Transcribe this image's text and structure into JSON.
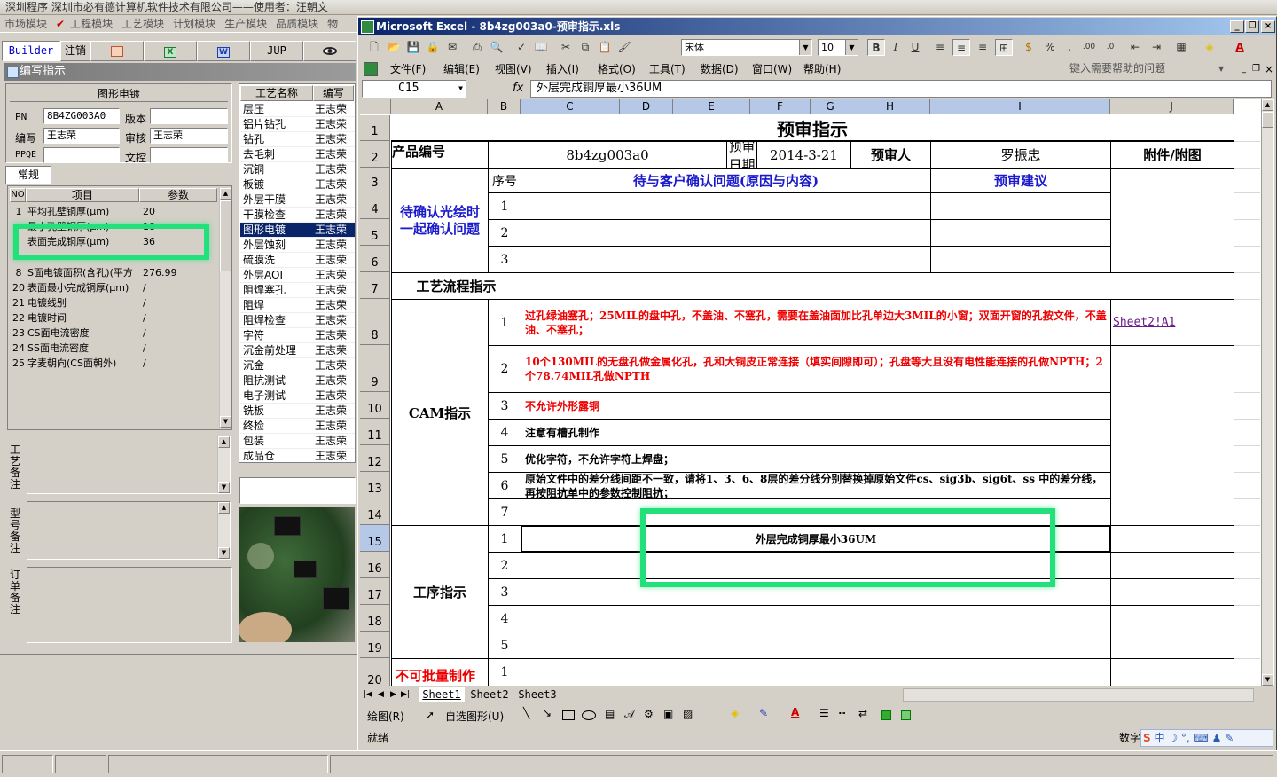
{
  "app": {
    "company_bar": "深圳程序    深圳市必有德计算机软件技术有限公司——使用者：汪朝文",
    "menu": [
      "市场模块",
      "工程模块",
      "工艺模块",
      "计划模块",
      "生产模块",
      "品质模块",
      "物"
    ]
  },
  "toolbar_tabs": [
    {
      "label": "Builder",
      "icon": null
    },
    {
      "label": "注销",
      "icon": null
    },
    {
      "label": "",
      "icon": "powerpoint-icon"
    },
    {
      "label": "",
      "icon": "excel-icon"
    },
    {
      "label": "",
      "icon": "word-icon"
    },
    {
      "label": "JUP",
      "icon": null
    },
    {
      "label": "",
      "icon": "eye-icon"
    }
  ],
  "panel": {
    "title": "编写指示",
    "section_title": "图形电镀",
    "fields": {
      "pn_label": "PN",
      "pn_value": "8B4ZG003A0",
      "version_label": "版本",
      "version_value": "",
      "writer_label": "编写",
      "writer_value": "王志荣",
      "reviewer_label": "审核",
      "reviewer_value": "王志荣",
      "ppqe_label": "PPQE",
      "ppqe_value": "",
      "doc_label": "文控",
      "doc_value": ""
    },
    "tab": "常规",
    "grid_headers": [
      "NO",
      "项目",
      "参数"
    ],
    "grid_rows": [
      {
        "no": "1",
        "item": "平均孔壁铜厚(μm)",
        "val": "20"
      },
      {
        "no": "",
        "item": "最小孔壁铜厚(μm)",
        "val": "18"
      },
      {
        "no": "",
        "item": "表面完成铜厚(μm)",
        "val": "36"
      },
      {
        "no": "",
        "item": "",
        "val": ""
      },
      {
        "no": "8",
        "item": "S面电镀面积(含孔)(平方",
        "val": "276.99"
      },
      {
        "no": "20",
        "item": "表面最小完成铜厚(μm)",
        "val": "/"
      },
      {
        "no": "21",
        "item": "电镀线别",
        "val": "/"
      },
      {
        "no": "22",
        "item": "电镀时间",
        "val": "/"
      },
      {
        "no": "23",
        "item": "CS面电流密度",
        "val": "/"
      },
      {
        "no": "24",
        "item": "SS面电流密度",
        "val": "/"
      },
      {
        "no": "25",
        "item": "字麦朝向(CS面朝外)",
        "val": "/"
      }
    ],
    "notes": [
      "工艺备注",
      "型号备注",
      "订单备注"
    ]
  },
  "process_list": {
    "headers": [
      "工艺名称",
      "编写"
    ],
    "rows": [
      {
        "name": "层压",
        "writer": "王志荣"
      },
      {
        "name": "铝片钻孔",
        "writer": "王志荣"
      },
      {
        "name": "钻孔",
        "writer": "王志荣"
      },
      {
        "name": "去毛刺",
        "writer": "王志荣"
      },
      {
        "name": "沉铜",
        "writer": "王志荣"
      },
      {
        "name": "板镀",
        "writer": "王志荣"
      },
      {
        "name": "外层干膜",
        "writer": "王志荣"
      },
      {
        "name": "干膜检查",
        "writer": "王志荣"
      },
      {
        "name": "图形电镀",
        "writer": "王志荣",
        "selected": true
      },
      {
        "name": "外层蚀刻",
        "writer": "王志荣"
      },
      {
        "name": "硫膜洗",
        "writer": "王志荣"
      },
      {
        "name": "外层AOI",
        "writer": "王志荣"
      },
      {
        "name": "阻焊塞孔",
        "writer": "王志荣"
      },
      {
        "name": "阻焊",
        "writer": "王志荣"
      },
      {
        "name": "阻焊检查",
        "writer": "王志荣"
      },
      {
        "name": "字符",
        "writer": "王志荣"
      },
      {
        "name": "沉金前处理",
        "writer": "王志荣"
      },
      {
        "name": "沉金",
        "writer": "王志荣"
      },
      {
        "name": "阻抗测试",
        "writer": "王志荣"
      },
      {
        "name": "电子测试",
        "writer": "王志荣"
      },
      {
        "name": "铣板",
        "writer": "王志荣"
      },
      {
        "name": "终检",
        "writer": "王志荣"
      },
      {
        "name": "包装",
        "writer": "王志荣"
      },
      {
        "name": "成品仓",
        "writer": "王志荣"
      }
    ]
  },
  "excel": {
    "title": "Microsoft Excel - 8b4zg003a0-预审指示.xls",
    "font_name": "宋体",
    "font_size": "10",
    "menus": [
      "文件(F)",
      "编辑(E)",
      "视图(V)",
      "插入(I)",
      "格式(O)",
      "工具(T)",
      "数据(D)",
      "窗口(W)",
      "帮助(H)"
    ],
    "help_placeholder": "键入需要帮助的问题",
    "name_box": "C15",
    "fx": "fx",
    "formula": "外层完成铜厚最小36UM",
    "columns": [
      "A",
      "B",
      "C",
      "D",
      "E",
      "F",
      "G",
      "H",
      "I",
      "J"
    ],
    "rows": [
      "1",
      "2",
      "3",
      "4",
      "5",
      "6",
      "7",
      "8",
      "9",
      "10",
      "11",
      "12",
      "13",
      "14",
      "15",
      "16",
      "17",
      "18",
      "19",
      "20"
    ],
    "sheet": {
      "title": "预审指示",
      "product_no_label": "产品编号",
      "product_no": "8b4zg003a0",
      "review_date_label": "预审日期",
      "review_date": "2014-3-21",
      "reviewer_label": "预审人",
      "reviewer": "罗振忠",
      "attachment_label": "附件/附图",
      "seq_label": "序号",
      "confirm_header": "待与客户确认问题(原因与内容)",
      "suggest_header": "预审建议",
      "confirm_group": "待确认光绘时一起确认问题",
      "confirm_seq": [
        "1",
        "2",
        "3"
      ],
      "flow_label": "工艺流程指示",
      "cam_label": "CAM指示",
      "cam_items": [
        {
          "n": "1",
          "text": "过孔绿油塞孔；25MIL的盘中孔，不盖油、不塞孔，需要在盖油面加比孔单边大3MIL的小窗；双面开窗的孔按文件，不盖油、不塞孔；",
          "red": true
        },
        {
          "n": "2",
          "text": "10个130MIL的无盘孔做金属化孔，孔和大铜皮正常连接（填实间隙即可）；孔盘等大且没有电性能连接的孔做NPTH；2个78.74MIL孔做NPTH",
          "red": true
        },
        {
          "n": "3",
          "text": "不允许外形露铜",
          "red": true
        },
        {
          "n": "4",
          "text": "注意有槽孔制作",
          "red": false
        },
        {
          "n": "5",
          "text": "优化字符，不允许字符上焊盘；",
          "red": false
        },
        {
          "n": "6",
          "text": "原始文件中的差分线间距不一致，请将1、3、6、8层的差分线分别替换掉原始文件cs、sig3b、sig6t、ss 中的差分线，再按阻抗单中的参数控制阻抗；",
          "red": false
        },
        {
          "n": "7",
          "text": "",
          "red": false
        }
      ],
      "attachment_link": "Sheet2!A1",
      "process_label": "工序指示",
      "process_items": [
        {
          "n": "1",
          "text": "外层完成铜厚最小36UM"
        },
        {
          "n": "2",
          "text": ""
        },
        {
          "n": "3",
          "text": ""
        },
        {
          "n": "4",
          "text": ""
        },
        {
          "n": "5",
          "text": ""
        }
      ],
      "nobatch_label": "不可批量制作",
      "nobatch_seq": "1"
    },
    "sheet_tabs": [
      "Sheet1",
      "Sheet2",
      "Sheet3"
    ],
    "draw_label": "绘图(R)",
    "autoshape_label": "自选图形(U)",
    "status_ready": "就绪",
    "status_num": "数字",
    "ime": "中"
  },
  "colors": {
    "highlight": "#22e07a",
    "red_text": "#e00000",
    "blue_text": "#1a1acc",
    "selection": "#0a246a"
  }
}
